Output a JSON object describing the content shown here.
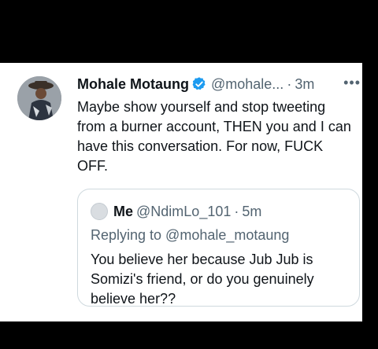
{
  "tweet": {
    "author_name": "Mohale Motaung",
    "author_handle": "@mohale...",
    "separator": "·",
    "time": "3m",
    "more": "•••",
    "text": "Maybe show yourself and stop tweeting from a burner account, THEN you and I can have this conversation. For now, FUCK OFF.",
    "verified_color": "#1d9bf0"
  },
  "quoted_tweet": {
    "author_name": "Me",
    "author_handle": "@NdimLo_101",
    "separator": "·",
    "time": "5m",
    "replying_to": "Replying to @mohale_motaung",
    "text": "You believe her because Jub Jub is Somizi's friend, or do you genuinely believe her??"
  },
  "colors": {
    "background": "#000000",
    "card": "#ffffff",
    "primary_text": "#0f1419",
    "secondary_text": "#536471",
    "border": "#cfd9de"
  }
}
